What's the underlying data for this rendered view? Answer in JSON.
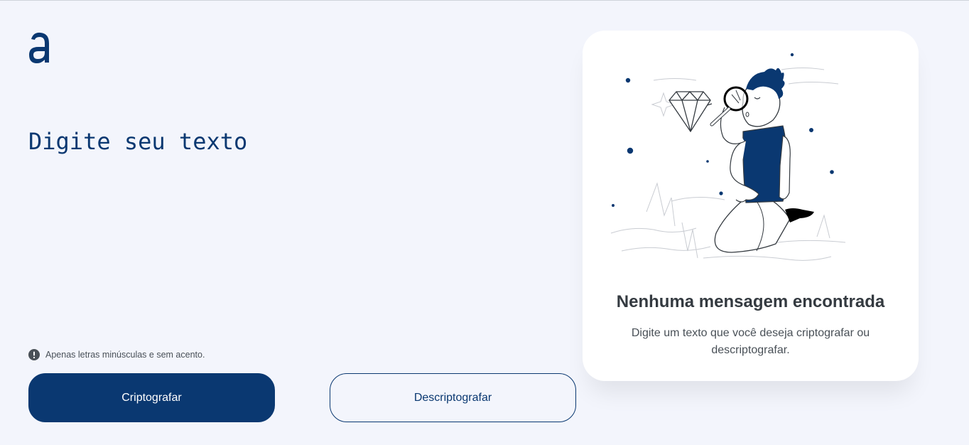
{
  "logo": {
    "icon": "alura-logo-icon"
  },
  "input": {
    "placeholder": "Digite seu texto",
    "value": ""
  },
  "hint": {
    "icon": "exclamation-circle-icon",
    "text": "Apenas letras minúsculas e sem acento."
  },
  "buttons": {
    "encrypt_label": "Criptografar",
    "decrypt_label": "Descriptografar"
  },
  "output": {
    "illustration": "person-with-magnifying-glass-illustration",
    "title": "Nenhuma mensagem encontrada",
    "text": "Digite um texto que você deseja criptografar ou descriptografar."
  },
  "colors": {
    "primary": "#0a3871",
    "background": "#f3f5fc",
    "card": "#ffffff",
    "title": "#343a40",
    "muted": "#495057"
  }
}
